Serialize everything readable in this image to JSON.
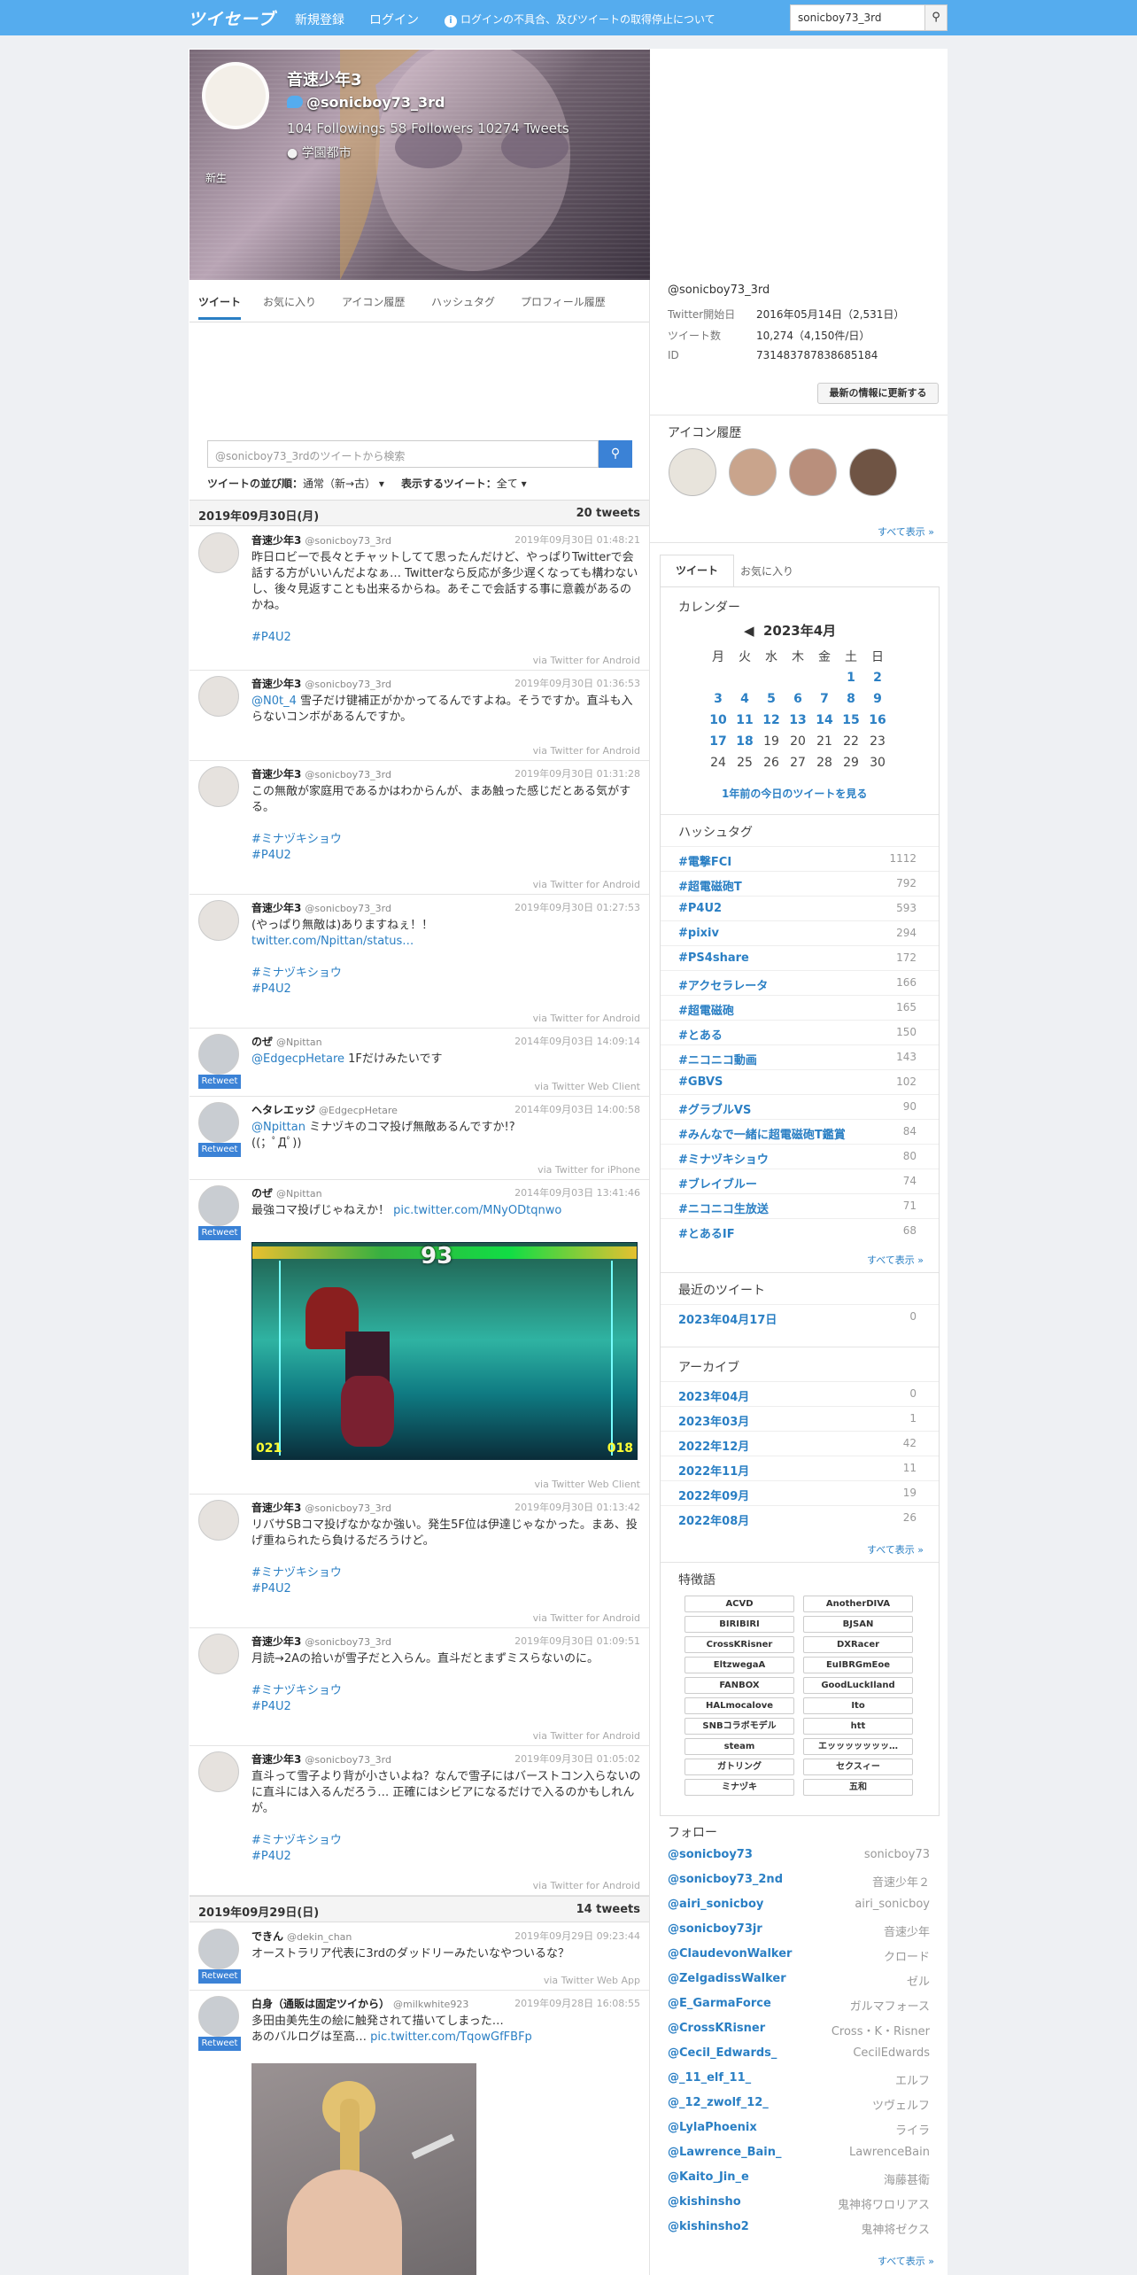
{
  "header": {
    "logo": "ツイセーブ",
    "signup": "新規登録",
    "login": "ログイン",
    "notice": "ログインの不具合、及びツイートの取得停止について",
    "search_value": "sonicboy73_3rd"
  },
  "profile": {
    "name": "音速少年3",
    "handle": "@sonicboy73_3rd",
    "stats": "104 Followings  58 Followers  10274 Tweets",
    "location": "学園都市",
    "bio": "新生"
  },
  "tabs": [
    "ツイート",
    "お気に入り",
    "アイコン履歴",
    "ハッシュタグ",
    "プロフィール履歴"
  ],
  "tweet_search": {
    "placeholder": "@sonicboy73_3rdのツイートから検索",
    "sort_label": "ツイートの並び順：",
    "sort_value": "通常（新→古）",
    "show_label": "表示するツイート：",
    "show_value": "全て"
  },
  "days": [
    {
      "date": "2019年09月30日(月)",
      "count": "20 tweets"
    },
    {
      "date": "2019年09月29日(日)",
      "count": "14 tweets"
    }
  ],
  "tweets": [
    {
      "name": "音速少年3",
      "handle": "@sonicboy73_3rd",
      "time": "2019年09月30日 01:48:21",
      "text": "昨日ロビーで長々とチャットしてて思ったんだけど、やっぱりTwitterで会話する方がいいんだよなぁ… Twitterなら反応が多少遅くなっても構わないし、後々見返すことも出来るからね。あそこで会話する事に意義があるのかね。",
      "tags": "#P4U2",
      "via": "via Twitter for Android"
    },
    {
      "name": "音速少年3",
      "handle": "@sonicboy73_3rd",
      "time": "2019年09月30日 01:36:53",
      "mention": "@N0t_4",
      "text": " 雪子だけ键補正がかかってるんですよね。そうですか。直斗も入らないコンボがあるんですか。",
      "via": "via Twitter for Android"
    },
    {
      "name": "音速少年3",
      "handle": "@sonicboy73_3rd",
      "time": "2019年09月30日 01:31:28",
      "text": "この無敵が家庭用であるかはわからんが、まあ触った感じだとある気がする。",
      "tags": "#ミナヅキショウ",
      "tags2": "#P4U2",
      "via": "via Twitter for Android"
    },
    {
      "name": "音速少年3",
      "handle": "@sonicboy73_3rd",
      "time": "2019年09月30日 01:27:53",
      "text": "(やっぱり無敵は)ありますねぇ！！",
      "link": "twitter.com/Npittan/status…",
      "tags": "#ミナヅキショウ",
      "tags2": "#P4U2",
      "via": "via Twitter for Android"
    },
    {
      "name": "のぜ",
      "handle": "@Npittan",
      "time": "2014年09月03日 14:09:14",
      "mention": "@EdgecpHetare",
      "text": " 1Fだけみたいです",
      "via": "via Twitter Web Client",
      "rt": "Retweet"
    },
    {
      "name": "ヘタレエッジ",
      "handle": "@EdgecpHetare",
      "time": "2014年09月03日 14:00:58",
      "mention": "@Npittan",
      "text": " ミナヅキのコマ投げ無敵あるんですか!?",
      "text2": "((；ﾟДﾟ))",
      "via": "via Twitter for iPhone",
      "rt": "Retweet"
    },
    {
      "name": "のぜ",
      "handle": "@Npittan",
      "time": "2014年09月03日 13:41:46",
      "text": "最強コマ投げじゃねえか！ ",
      "link": "pic.twitter.com/MNyODtqnwo",
      "via": "via Twitter Web Client",
      "rt": "Retweet",
      "img_num": "93",
      "img_l": "021",
      "img_r": "018"
    },
    {
      "name": "音速少年3",
      "handle": "@sonicboy73_3rd",
      "time": "2019年09月30日 01:13:42",
      "text": "リバサSBコマ投げなかなか強い。発生5F位は伊達じゃなかった。まあ、投げ重ねられたら負けるだろうけど。",
      "tags": "#ミナヅキショウ",
      "tags2": "#P4U2",
      "via": "via Twitter for Android"
    },
    {
      "name": "音速少年3",
      "handle": "@sonicboy73_3rd",
      "time": "2019年09月30日 01:09:51",
      "text": "月読→2Aの拾いが雪子だと入らん。直斗だとまずミスらないのに。",
      "tags": "#ミナヅキショウ",
      "tags2": "#P4U2",
      "via": "via Twitter for Android"
    },
    {
      "name": "音速少年3",
      "handle": "@sonicboy73_3rd",
      "time": "2019年09月30日 01:05:02",
      "text": "直斗って雪子より背が小さいよね？なんで雪子にはバーストコン入らないのに直斗には入るんだろう… 正確にはシビアになるだけで入るのかもしれんが。",
      "tags": "#ミナヅキショウ",
      "tags2": "#P4U2",
      "via": "via Twitter for Android"
    },
    {
      "name": "できん",
      "handle": "@dekin_chan",
      "time": "2019年09月29日 09:23:44",
      "text": "オーストラリア代表に3rdのダッドリーみたいなやついるな？",
      "via": "via Twitter Web App",
      "rt": "Retweet"
    },
    {
      "name": "白身（通販は固定ツイから）",
      "handle": "@milkwhite923",
      "time": "2019年09月28日 16:08:55",
      "text": "多田由美先生の絵に触発されて描いてしまった…",
      "text2": "あのバルログは至高… ",
      "link": "pic.twitter.com/TqowGfFBFp",
      "rt": "Retweet"
    }
  ],
  "account": {
    "handle": "@sonicboy73_3rd",
    "rows": [
      [
        "Twitter開始日",
        "2016年05月14日（2,531日）"
      ],
      [
        "ツイート数",
        "10,274（4,150件/日）"
      ],
      [
        "ID",
        "731483787838685184"
      ]
    ],
    "update_btn": "最新の情報に更新する"
  },
  "icon_history": {
    "title": "アイコン履歴",
    "more": "すべて表示 »"
  },
  "side_tabs": [
    "ツイート",
    "お気に入り"
  ],
  "calendar": {
    "title": "カレンダー",
    "month": "2023年4月",
    "prev": "◀",
    "weekdays": [
      "月",
      "火",
      "水",
      "木",
      "金",
      "土",
      "日"
    ],
    "weeks": [
      [
        "",
        "",
        "",
        "",
        "",
        "1",
        "2"
      ],
      [
        "3",
        "4",
        "5",
        "6",
        "7",
        "8",
        "9"
      ],
      [
        "10",
        "11",
        "12",
        "13",
        "14",
        "15",
        "16"
      ],
      [
        "17",
        "18",
        "19",
        "20",
        "21",
        "22",
        "23"
      ],
      [
        "24",
        "25",
        "26",
        "27",
        "28",
        "29",
        "30"
      ]
    ],
    "link": "1年前の今日のツイートを見る"
  },
  "hashtags": {
    "title": "ハッシュタグ",
    "items": [
      [
        "#電撃FCI",
        "1112"
      ],
      [
        "#超電磁砲T",
        "792"
      ],
      [
        "#P4U2",
        "593"
      ],
      [
        "#pixiv",
        "294"
      ],
      [
        "#PS4share",
        "172"
      ],
      [
        "#アクセラレータ",
        "166"
      ],
      [
        "#超電磁砲",
        "165"
      ],
      [
        "#とある",
        "150"
      ],
      [
        "#ニコニコ動画",
        "143"
      ],
      [
        "#GBVS",
        "102"
      ],
      [
        "#グラブルVS",
        "90"
      ],
      [
        "#みんなで一緒に超電磁砲T鑑賞",
        "84"
      ],
      [
        "#ミナヅキショウ",
        "80"
      ],
      [
        "#ブレイブルー",
        "74"
      ],
      [
        "#ニコニコ生放送",
        "71"
      ],
      [
        "#とあるIF",
        "68"
      ]
    ],
    "more": "すべて表示 »"
  },
  "recent": {
    "title": "最近のツイート",
    "items": [
      [
        "2023年04月17日",
        "0"
      ]
    ]
  },
  "archive": {
    "title": "アーカイブ",
    "items": [
      [
        "2023年04月",
        "0"
      ],
      [
        "2023年03月",
        "1"
      ],
      [
        "2022年12月",
        "42"
      ],
      [
        "2022年11月",
        "11"
      ],
      [
        "2022年09月",
        "19"
      ],
      [
        "2022年08月",
        "26"
      ]
    ],
    "more": "すべて表示 »"
  },
  "words": {
    "title": "特徴語",
    "items": [
      "ACVD",
      "AnotherDIVA",
      "BIRIBIRI",
      "BJSAN",
      "CrossKRisner",
      "DXRacer",
      "EltzwegaA",
      "EuIBRGmEoe",
      "FANBOX",
      "GoodLuckIland",
      "HALmocalove",
      "Ito",
      "SNBコラボモデル",
      "htt",
      "steam",
      "エッッッッッッッ…",
      "ガトリング",
      "セクスィー",
      "ミナヅキ",
      "五和"
    ]
  },
  "follow": {
    "title": "フォロー",
    "items": [
      [
        "@sonicboy73",
        "sonicboy73"
      ],
      [
        "@sonicboy73_2nd",
        "音速少年２"
      ],
      [
        "@airi_sonicboy",
        "airi_sonicboy"
      ],
      [
        "@sonicboy73jr",
        "音速少年"
      ],
      [
        "@ClaudevonWalker",
        "クロード"
      ],
      [
        "@ZelgadissWalker",
        "ゼル"
      ],
      [
        "@E_GarmaForce",
        "ガルマフォース"
      ],
      [
        "@CrossKRisner",
        "Cross・K・Risner"
      ],
      [
        "@Cecil_Edwards_",
        "CecilEdwards"
      ],
      [
        "@_11_elf_11_",
        "エルフ"
      ],
      [
        "@_12_zwolf_12_",
        "ツヴェルフ"
      ],
      [
        "@LylaPhoenix",
        "ライラ"
      ],
      [
        "@Lawrence_Bain_",
        "LawrenceBain"
      ],
      [
        "@Kaito_Jin_e",
        "海藤甚衛"
      ],
      [
        "@kishinsho",
        "鬼神将ワロリアス"
      ],
      [
        "@kishinsho2",
        "鬼神将ゼクス"
      ]
    ],
    "more": "すべて表示 »"
  },
  "colors": {
    "header": "#55acee",
    "link": "#2a7fc4",
    "retweet": "#3b82d6"
  }
}
